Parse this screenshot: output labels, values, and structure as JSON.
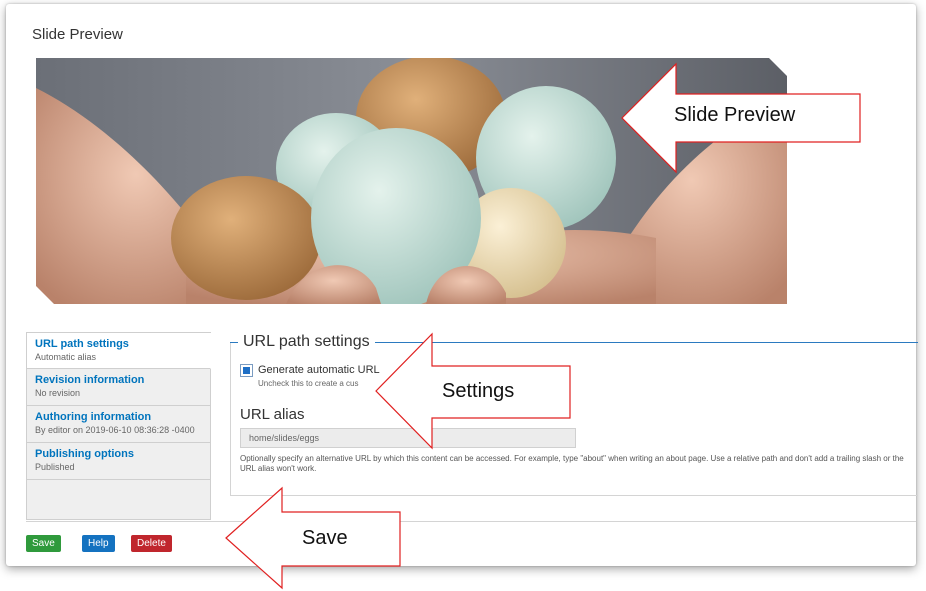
{
  "page": {
    "title": "Slide Preview"
  },
  "tabs": [
    {
      "title": "URL path settings",
      "subtitle": "Automatic alias"
    },
    {
      "title": "Revision information",
      "subtitle": "No revision"
    },
    {
      "title": "Authoring information",
      "subtitle": "By editor on 2019-06-10 08:36:28 -0400"
    },
    {
      "title": "Publishing options",
      "subtitle": "Published"
    }
  ],
  "url_settings": {
    "legend": "URL path settings",
    "checkbox_label": "Generate automatic URL",
    "checkbox_desc": "Uncheck this to create a cus",
    "checkbox_checked": true,
    "alias_label": "URL alias",
    "alias_value": "home/slides/eggs",
    "help_text": "Optionally specify an alternative URL by which this content can be accessed. For example, type \"about\" when writing an about page. Use a relative path and don't add a trailing slash or the URL alias won't work."
  },
  "buttons": {
    "save": "Save",
    "help": "Help",
    "delete": "Delete"
  },
  "annotations": {
    "preview": "Slide Preview",
    "settings": "Settings",
    "save": "Save"
  },
  "colors": {
    "link": "#0074bd",
    "save": "#2f9a3c",
    "help": "#1472c0",
    "delete": "#c0262d",
    "callout_border": "#e02020"
  }
}
